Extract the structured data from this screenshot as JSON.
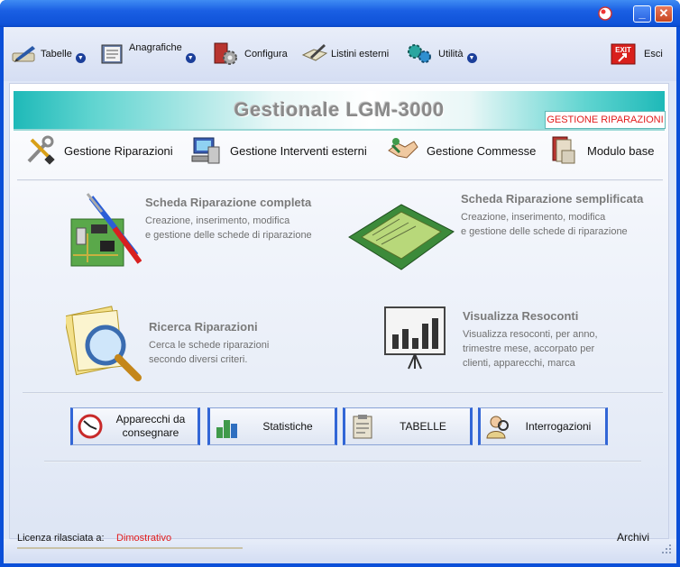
{
  "window": {
    "min_glyph": "_",
    "close_glyph": "✕"
  },
  "toolbar": {
    "items": [
      {
        "label": "Tabelle",
        "icon": "pen-icon",
        "has_menu": true
      },
      {
        "label": "Anagrafiche",
        "icon": "address-book-icon",
        "has_menu": true
      },
      {
        "label": "Configura",
        "icon": "gear-icon",
        "has_menu": false
      },
      {
        "label": "Listini esterni",
        "icon": "writing-icon",
        "has_menu": false
      },
      {
        "label": "Utilità",
        "icon": "gears-icon",
        "has_menu": true
      },
      {
        "label": "Esci",
        "icon": "exit-icon",
        "has_menu": false
      }
    ],
    "exit_badge": "EXIT"
  },
  "banner": {
    "title": "Gestionale LGM-3000",
    "tag": "GESTIONE RIPARAZIONI"
  },
  "nav": [
    {
      "label": "Gestione Riparazioni"
    },
    {
      "label": "Gestione Interventi esterni"
    },
    {
      "label": "Gestione Commesse"
    },
    {
      "label": "Modulo base"
    }
  ],
  "features": [
    {
      "title": "Scheda Riparazione completa",
      "desc": "Creazione, inserimento, modifica\ne gestione delle schede di riparazione"
    },
    {
      "title": "Scheda Riparazione semplificata",
      "desc": "Creazione, inserimento, modifica\ne gestione delle schede di riparazione"
    },
    {
      "title": "Ricerca Riparazioni",
      "desc": "Cerca le schede riparazioni\nsecondo diversi criteri."
    },
    {
      "title": "Visualizza Resoconti",
      "desc": "Visualizza resoconti, per anno,\ntrimestre mese, accorpato per\nclienti, apparecchi, marca"
    }
  ],
  "buttons": [
    {
      "label": "Apparecchi da consegnare"
    },
    {
      "label": "Statistiche"
    },
    {
      "label": "TABELLE"
    },
    {
      "label": "Interrogazioni"
    }
  ],
  "status": {
    "license_label": "Licenza rilasciata a:",
    "license_value": "Dimostrativo",
    "archive_label": "Archivi"
  },
  "colors": {
    "title_bar": "#0f52d8",
    "accent_red": "#e21b1b",
    "banner_teal": "#1eb9b8"
  }
}
